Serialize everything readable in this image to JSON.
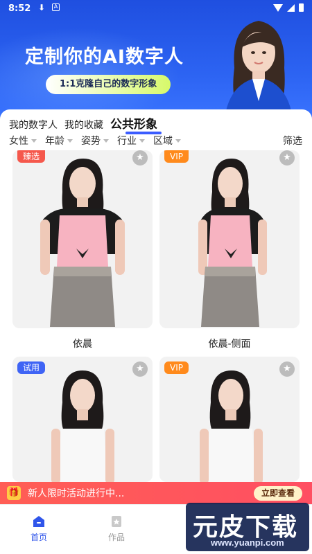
{
  "status_bar": {
    "time": "8:52",
    "download_glyph": "⬇",
    "app_glyph": "A"
  },
  "hero": {
    "title": "定制你的AI数字人",
    "pill": "1:1克隆自己的数字形象"
  },
  "tabs": [
    {
      "label": "我的数字人",
      "active": false
    },
    {
      "label": "我的收藏",
      "active": false
    },
    {
      "label": "公共形象",
      "active": true
    }
  ],
  "filters": [
    {
      "label": "女性"
    },
    {
      "label": "年龄"
    },
    {
      "label": "姿势"
    },
    {
      "label": "行业"
    },
    {
      "label": "区域"
    }
  ],
  "filter_button": "筛选",
  "cards": [
    {
      "name": "依晨",
      "tag": "臻选",
      "tag_color": "#f5584c",
      "fav_glyph": "★"
    },
    {
      "name": "依晨-侧面",
      "tag": "VIP",
      "tag_color": "#ff8a1c",
      "fav_glyph": "★"
    },
    {
      "name": "",
      "tag": "试用",
      "tag_color": "#3f64f5",
      "fav_glyph": "★"
    },
    {
      "name": "",
      "tag": "VIP",
      "tag_color": "#ff8a1c",
      "fav_glyph": "★"
    }
  ],
  "promo": {
    "icon_glyph": "🎁",
    "text": "新人限时活动进行中...",
    "button": "立即查看"
  },
  "nav": [
    {
      "label": "首页",
      "icon": "home-icon",
      "active": true
    },
    {
      "label": "作品",
      "icon": "works-icon",
      "active": false
    }
  ],
  "watermark": {
    "brand": "元皮下载",
    "url": "www.yuanpi.com"
  },
  "colors": {
    "accent": "#2f55ea",
    "hero": "#2c63f2",
    "promo": "#ff5458"
  }
}
